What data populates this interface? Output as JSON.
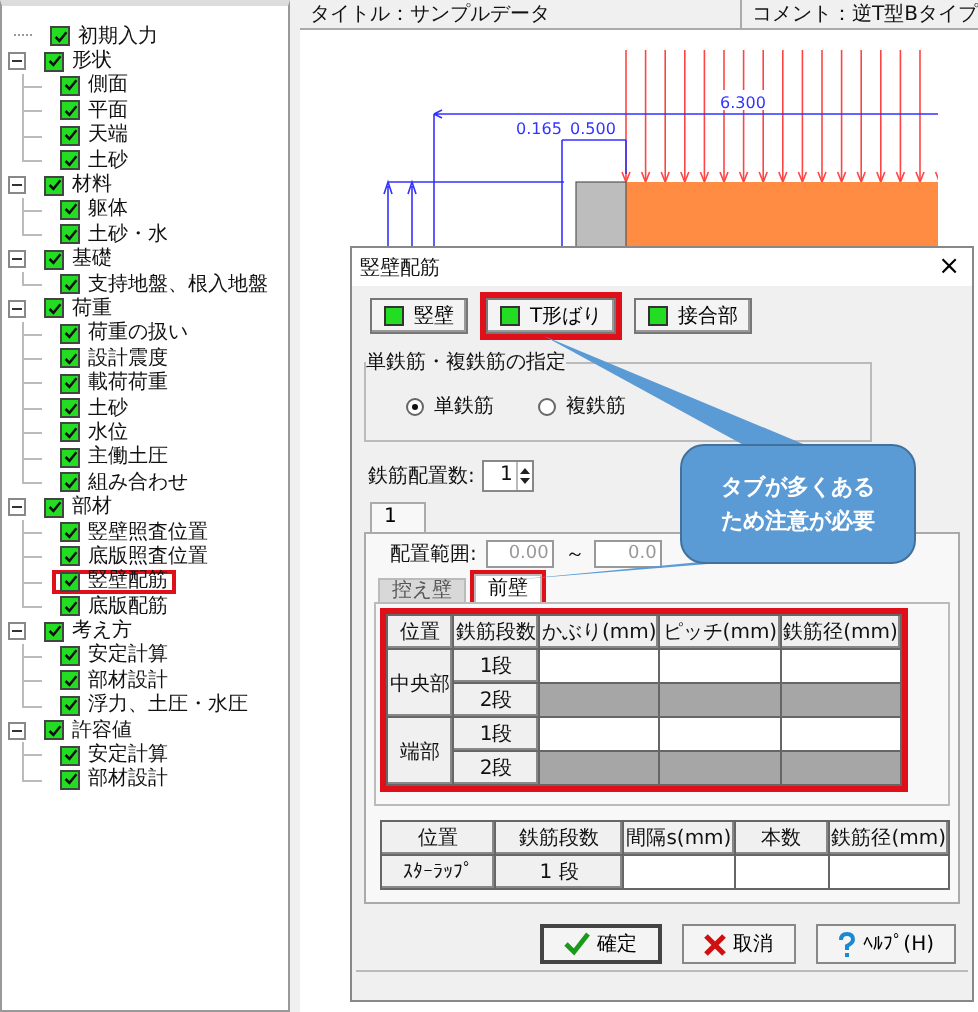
{
  "header": {
    "title": "タイトル：サンプルデータ",
    "comment": "コメント：逆T型Bタイプ"
  },
  "tree": [
    {
      "label": "初期入力",
      "checked": true,
      "highlighted": false
    },
    {
      "label": "形状",
      "checked": true,
      "expanded": true,
      "highlighted": false,
      "children": [
        {
          "label": "側面",
          "checked": true,
          "highlighted": false
        },
        {
          "label": "平面",
          "checked": true,
          "highlighted": false
        },
        {
          "label": "天端",
          "checked": true,
          "highlighted": false
        },
        {
          "label": "土砂",
          "checked": true,
          "highlighted": false
        }
      ]
    },
    {
      "label": "材料",
      "checked": true,
      "expanded": true,
      "highlighted": false,
      "children": [
        {
          "label": "躯体",
          "checked": true,
          "highlighted": false
        },
        {
          "label": "土砂・水",
          "checked": true,
          "highlighted": false
        }
      ]
    },
    {
      "label": "基礎",
      "checked": true,
      "expanded": true,
      "highlighted": false,
      "children": [
        {
          "label": "支持地盤、根入地盤",
          "checked": true,
          "highlighted": false
        }
      ]
    },
    {
      "label": "荷重",
      "checked": true,
      "expanded": true,
      "highlighted": false,
      "children": [
        {
          "label": "荷重の扱い",
          "checked": true,
          "highlighted": false
        },
        {
          "label": "設計震度",
          "checked": true,
          "highlighted": false
        },
        {
          "label": "載荷荷重",
          "checked": true,
          "highlighted": false
        },
        {
          "label": "土砂",
          "checked": true,
          "highlighted": false
        },
        {
          "label": "水位",
          "checked": true,
          "highlighted": false
        },
        {
          "label": "主働土圧",
          "checked": true,
          "highlighted": false
        },
        {
          "label": "組み合わせ",
          "checked": true,
          "highlighted": false
        }
      ]
    },
    {
      "label": "部材",
      "checked": true,
      "expanded": true,
      "highlighted": false,
      "children": [
        {
          "label": "竪壁照査位置",
          "checked": true,
          "highlighted": false
        },
        {
          "label": "底版照査位置",
          "checked": true,
          "highlighted": false
        },
        {
          "label": "竪壁配筋",
          "checked": true,
          "highlighted": true
        },
        {
          "label": "底版配筋",
          "checked": true,
          "highlighted": false
        }
      ]
    },
    {
      "label": "考え方",
      "checked": true,
      "expanded": true,
      "highlighted": false,
      "children": [
        {
          "label": "安定計算",
          "checked": true,
          "highlighted": false
        },
        {
          "label": "部材設計",
          "checked": true,
          "highlighted": false
        },
        {
          "label": "浮力、土圧・水圧",
          "checked": true,
          "highlighted": false
        }
      ]
    },
    {
      "label": "許容値",
      "checked": true,
      "expanded": true,
      "highlighted": false,
      "children": [
        {
          "label": "安定計算",
          "checked": true,
          "highlighted": false
        },
        {
          "label": "部材設計",
          "checked": true,
          "highlighted": false
        }
      ]
    }
  ],
  "drawing": {
    "span": "6.300",
    "offset_1": "0.165",
    "offset_2": "0.500"
  },
  "dialog": {
    "title": "竪壁配筋",
    "close": "×",
    "parts": [
      {
        "label": "竪壁",
        "on": true,
        "highlighted": false
      },
      {
        "label": "T形ばり",
        "on": true,
        "highlighted": true
      },
      {
        "label": "接合部",
        "on": true,
        "highlighted": false
      }
    ],
    "reinforcement": {
      "legend": "単鉄筋・複鉄筋の指定",
      "options": [
        {
          "label": "単鉄筋",
          "selected": true
        },
        {
          "label": "複鉄筋",
          "selected": false
        }
      ]
    },
    "count": {
      "label": "鉄筋配置数:",
      "value": "1"
    },
    "tabs": [
      {
        "label": "1",
        "selected": true
      }
    ],
    "range": {
      "label": "配置範囲:",
      "from": "0.00",
      "separator": "～",
      "to": "0.0"
    },
    "wall_tabs": [
      {
        "label": "控え壁",
        "selected": false,
        "highlighted": false
      },
      {
        "label": "前壁",
        "selected": true,
        "highlighted": true
      }
    ],
    "main_table": {
      "highlighted": true,
      "columns": [
        "位置",
        "鉄筋段数",
        "かぶり(mm)",
        "ピッチ(mm)",
        "鉄筋径(mm)"
      ],
      "groups": [
        {
          "position": "中央部",
          "rows": [
            {
              "tier": "1段",
              "disabled": false
            },
            {
              "tier": "2段",
              "disabled": true
            }
          ]
        },
        {
          "position": "端部",
          "rows": [
            {
              "tier": "1段",
              "disabled": false
            },
            {
              "tier": "2段",
              "disabled": true
            }
          ]
        }
      ]
    },
    "stirrup_table": {
      "columns": [
        "位置",
        "鉄筋段数",
        "間隔s(mm)",
        "本数",
        "鉄筋径(mm)"
      ],
      "rows": [
        {
          "position": "ｽﾀｰﾗｯﾌﾟ",
          "tier": "1 段"
        }
      ]
    },
    "buttons": [
      {
        "kind": "ok",
        "label": "確定"
      },
      {
        "kind": "cancel",
        "label": "取消"
      },
      {
        "kind": "help",
        "label": "ﾍﾙﾌﾟ(H)"
      }
    ]
  },
  "callout": {
    "text": "タブが多くあるため注意が必要"
  }
}
